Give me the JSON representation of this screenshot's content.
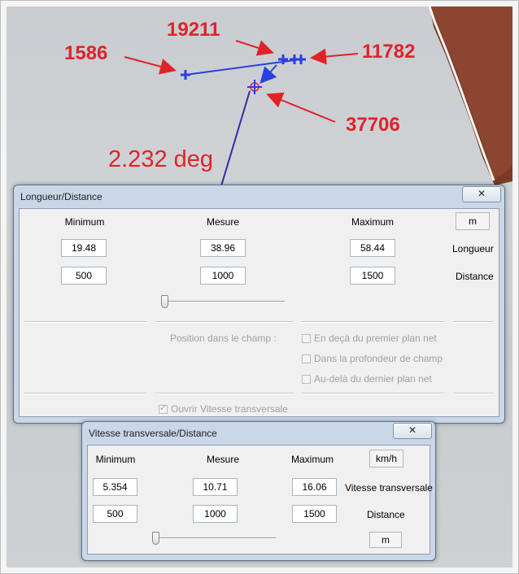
{
  "annotations": {
    "labels": [
      "19211",
      "1586",
      "11782",
      "37706"
    ],
    "angle": "2.232 deg",
    "colors": {
      "label": "#e0232a",
      "marker": "#2a3fe0",
      "line": "#3a2aa8"
    }
  },
  "window1": {
    "title": "Longueur/Distance",
    "close_icon": "✕",
    "headers": {
      "min": "Minimum",
      "mesure": "Mesure",
      "max": "Maximum"
    },
    "unit": "m",
    "rows": [
      {
        "min": "19.48",
        "mesure": "38.96",
        "max": "58.44",
        "label": "Longueur"
      },
      {
        "min": "500",
        "mesure": "1000",
        "max": "1500",
        "label": "Distance"
      }
    ],
    "slider_fraction": 0,
    "position_label": "Position dans le champ :",
    "options": [
      "En deçà du premier plan net",
      "Dans la profondeur de champ",
      "Au-delà du dernier plan net"
    ],
    "open_speed": {
      "label": "Ouvrir Vitesse transversale",
      "checked": true
    }
  },
  "window2": {
    "title": "Vitesse transversale/Distance",
    "close_icon": "✕",
    "headers": {
      "min": "Minimum",
      "mesure": "Mesure",
      "max": "Maximum"
    },
    "unit_speed": "km/h",
    "unit_distance": "m",
    "rows": [
      {
        "min": "5.354",
        "mesure": "10.71",
        "max": "16.06",
        "label": "Vitesse transversale"
      },
      {
        "min": "500",
        "mesure": "1000",
        "max": "1500",
        "label": "Distance"
      }
    ],
    "slider_fraction": 0
  }
}
